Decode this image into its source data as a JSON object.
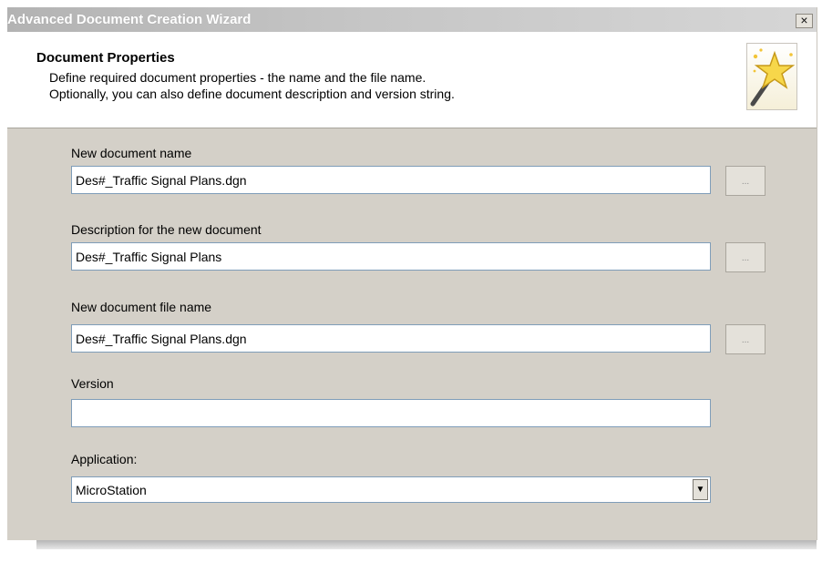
{
  "window": {
    "title": "Advanced Document Creation Wizard",
    "close_glyph": "×"
  },
  "header": {
    "title": "Document Properties",
    "line1": "Define required document properties - the name and the file name.",
    "line2": "Optionally, you can also define document description and version string.",
    "icon": "wizard-wand-star-icon"
  },
  "form": {
    "name": {
      "label": "New document name",
      "value": "Des#_Traffic Signal Plans.dgn"
    },
    "description": {
      "label": "Description for the new document",
      "value": "Des#_Traffic Signal Plans"
    },
    "file_name": {
      "label": "New document file name",
      "value": "Des#_Traffic Signal Plans.dgn"
    },
    "version": {
      "label": "Version",
      "value": ""
    },
    "application": {
      "label": "Application:",
      "value": "MicroStation"
    },
    "browse_label": "..."
  }
}
